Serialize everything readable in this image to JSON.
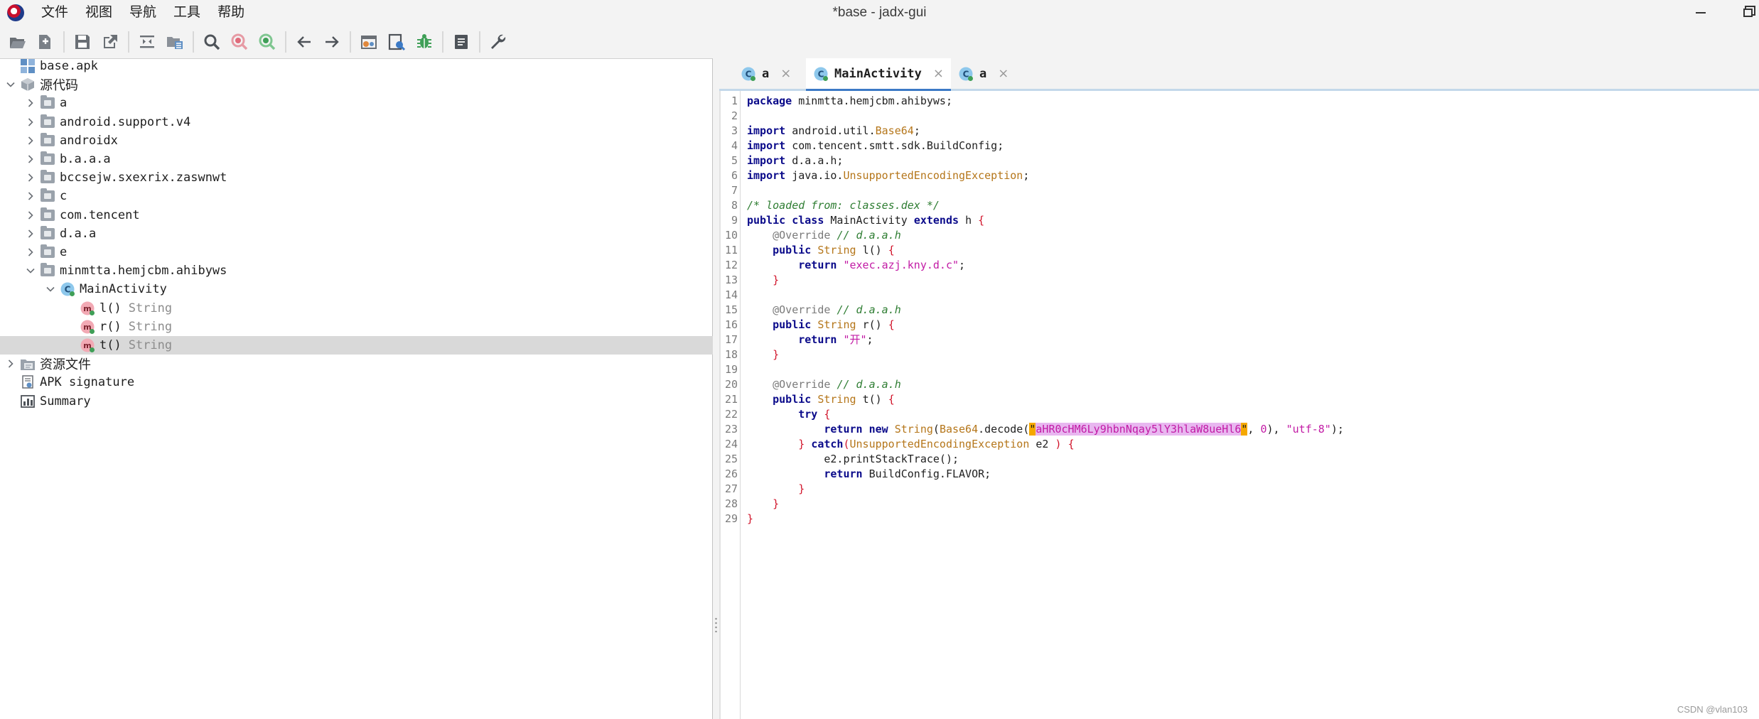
{
  "app": {
    "window_title": "*base - jadx-gui",
    "menu": [
      "文件",
      "视图",
      "导航",
      "工具",
      "帮助"
    ]
  },
  "toolbar": {
    "buttons": [
      "open-icon",
      "add-files-icon",
      "save-icon",
      "export-icon",
      "sync-tree-icon",
      "flatten-packages-icon",
      "search-icon",
      "find-class-icon",
      "find-usage-icon",
      "back-icon",
      "forward-icon",
      "deobfuscation-icon",
      "quark-icon",
      "debug-icon",
      "log-icon",
      "settings-icon"
    ]
  },
  "tree": {
    "items": [
      {
        "label": "base.apk",
        "level": 0,
        "icon": "apk-icon",
        "chevron": "none"
      },
      {
        "label": "源代码",
        "level": 0,
        "icon": "source-code-icon",
        "chevron": "expanded"
      },
      {
        "label": "a",
        "level": 1,
        "icon": "package-icon",
        "chevron": "collapsed"
      },
      {
        "label": "android.support.v4",
        "level": 1,
        "icon": "package-icon",
        "chevron": "collapsed"
      },
      {
        "label": "androidx",
        "level": 1,
        "icon": "package-icon",
        "chevron": "collapsed"
      },
      {
        "label": "b.a.a.a",
        "level": 1,
        "icon": "package-icon",
        "chevron": "collapsed"
      },
      {
        "label": "bccsejw.sxexrix.zaswnwt",
        "level": 1,
        "icon": "package-icon",
        "chevron": "collapsed"
      },
      {
        "label": "c",
        "level": 1,
        "icon": "package-icon",
        "chevron": "collapsed"
      },
      {
        "label": "com.tencent",
        "level": 1,
        "icon": "package-icon",
        "chevron": "collapsed"
      },
      {
        "label": "d.a.a",
        "level": 1,
        "icon": "package-icon",
        "chevron": "collapsed"
      },
      {
        "label": "e",
        "level": 1,
        "icon": "package-icon",
        "chevron": "collapsed"
      },
      {
        "label": "minmtta.hemjcbm.ahibyws",
        "level": 1,
        "icon": "package-icon",
        "chevron": "expanded"
      },
      {
        "label": "MainActivity",
        "level": 2,
        "icon": "class-icon",
        "chevron": "expanded"
      },
      {
        "label": "l()",
        "type": "String",
        "level": 3,
        "icon": "method-icon",
        "chevron": "none"
      },
      {
        "label": "r()",
        "type": "String",
        "level": 3,
        "icon": "method-icon",
        "chevron": "none"
      },
      {
        "label": "t()",
        "type": "String",
        "level": 3,
        "icon": "method-icon",
        "chevron": "none",
        "selected": true
      },
      {
        "label": "资源文件",
        "level": 0,
        "icon": "resources-icon",
        "chevron": "collapsed"
      },
      {
        "label": "APK signature",
        "level": 0,
        "icon": "certificate-icon",
        "chevron": "none"
      },
      {
        "label": "Summary",
        "level": 0,
        "icon": "summary-icon",
        "chevron": "none"
      }
    ]
  },
  "tabs": [
    {
      "label": "a",
      "active": false,
      "close": "×"
    },
    {
      "label": "MainActivity",
      "active": true,
      "close": "×"
    },
    {
      "label": "a",
      "active": false,
      "close": "×"
    }
  ],
  "code": {
    "lines": [
      [
        [
          "kw",
          "package"
        ],
        [
          "",
          "minmtta.hemjcbm.ahibyws;"
        ]
      ],
      [],
      [
        [
          "kw",
          "import"
        ],
        [
          "",
          "android.util."
        ],
        [
          "ty",
          "Base64"
        ],
        [
          "",
          ";"
        ]
      ],
      [
        [
          "kw",
          "import"
        ],
        [
          "",
          "com.tencent.smtt.sdk.BuildConfig;"
        ]
      ],
      [
        [
          "kw",
          "import"
        ],
        [
          "",
          "d.a.a.h;"
        ]
      ],
      [
        [
          "kw",
          "import"
        ],
        [
          "",
          "java.io."
        ],
        [
          "ty",
          "UnsupportedEncodingException"
        ],
        [
          "",
          ";"
        ]
      ],
      [],
      [
        [
          "cm",
          "/* loaded from: classes.dex */"
        ]
      ],
      [
        [
          "kw",
          "public"
        ],
        [
          "",
          ""
        ],
        [
          "kw",
          "class"
        ],
        [
          "",
          "MainActivity"
        ],
        [
          "kw",
          "extends"
        ],
        [
          "",
          "h"
        ],
        [
          "br",
          "{"
        ]
      ],
      [
        [
          "",
          "    "
        ],
        [
          "an",
          "@Override"
        ],
        [
          "cm",
          "// d.a.a.h"
        ]
      ],
      [
        [
          "",
          "    "
        ],
        [
          "kw",
          "public"
        ],
        [
          "ty",
          "String"
        ],
        [
          "",
          "l()"
        ],
        [
          "br",
          "{"
        ]
      ],
      [
        [
          "",
          "        "
        ],
        [
          "kw",
          "return"
        ],
        [
          "str",
          "\"exec.azj.kny.d.c\""
        ],
        [
          "",
          ";"
        ]
      ],
      [
        [
          "",
          "    "
        ],
        [
          "br",
          "}"
        ]
      ],
      [],
      [
        [
          "",
          "    "
        ],
        [
          "an",
          "@Override"
        ],
        [
          "cm",
          "// d.a.a.h"
        ]
      ],
      [
        [
          "",
          "    "
        ],
        [
          "kw",
          "public"
        ],
        [
          "ty",
          "String"
        ],
        [
          "",
          "r()"
        ],
        [
          "br",
          "{"
        ]
      ],
      [
        [
          "",
          "        "
        ],
        [
          "kw",
          "return"
        ],
        [
          "str",
          "\"开\""
        ],
        [
          "",
          ";"
        ]
      ],
      [
        [
          "",
          "    "
        ],
        [
          "br",
          "}"
        ]
      ],
      [],
      [
        [
          "",
          "    "
        ],
        [
          "an",
          "@Override"
        ],
        [
          "cm",
          "// d.a.a.h"
        ]
      ],
      [
        [
          "",
          "    "
        ],
        [
          "kw",
          "public"
        ],
        [
          "ty",
          "String"
        ],
        [
          "",
          "t()"
        ],
        [
          "br",
          "{"
        ]
      ],
      [
        [
          "",
          "        "
        ],
        [
          "kw",
          "try"
        ],
        [
          "br",
          "{"
        ]
      ],
      [
        [
          "",
          "            "
        ],
        [
          "kw",
          "return"
        ],
        [
          "kw",
          "new"
        ],
        [
          "ty",
          "String"
        ],
        [
          "",
          "("
        ],
        [
          "ty",
          "Base64"
        ],
        [
          "",
          ".decode("
        ],
        [
          "hl-q",
          "\""
        ],
        [
          "hl-str",
          "aHR0cHM6Ly9hbnNqay5lY3hlaW8ueHl6"
        ],
        [
          "hl-q",
          "\""
        ],
        [
          "",
          ", "
        ],
        [
          "num",
          "0"
        ],
        [
          "",
          "), "
        ],
        [
          "str",
          "\"utf-8\""
        ],
        [
          "",
          ");"
        ]
      ],
      [
        [
          "",
          "        "
        ],
        [
          "br",
          "}"
        ],
        [
          "kw",
          "catch"
        ],
        [
          "br",
          "("
        ],
        [
          "ty",
          "UnsupportedEncodingException"
        ],
        [
          "",
          "e2"
        ],
        [
          "br",
          ")"
        ],
        [
          "br",
          "{"
        ]
      ],
      [
        [
          "",
          "            e2.printStackTrace();"
        ]
      ],
      [
        [
          "",
          "            "
        ],
        [
          "kw",
          "return"
        ],
        [
          "",
          "BuildConfig.FLAVOR;"
        ]
      ],
      [
        [
          "",
          "        "
        ],
        [
          "br",
          "}"
        ]
      ],
      [
        [
          "",
          "    "
        ],
        [
          "br",
          "}"
        ]
      ],
      [
        [
          "br",
          "}"
        ]
      ]
    ]
  },
  "watermark": "CSDN @vlan103",
  "colors": {
    "keyword": "#0a0a8a",
    "type": "#b5761a",
    "string": "#c21ba5",
    "comment": "#2e7d32",
    "brace": "#d1152b",
    "tab_underline": "#3c7ac6",
    "selection": "#d9d9d9"
  }
}
